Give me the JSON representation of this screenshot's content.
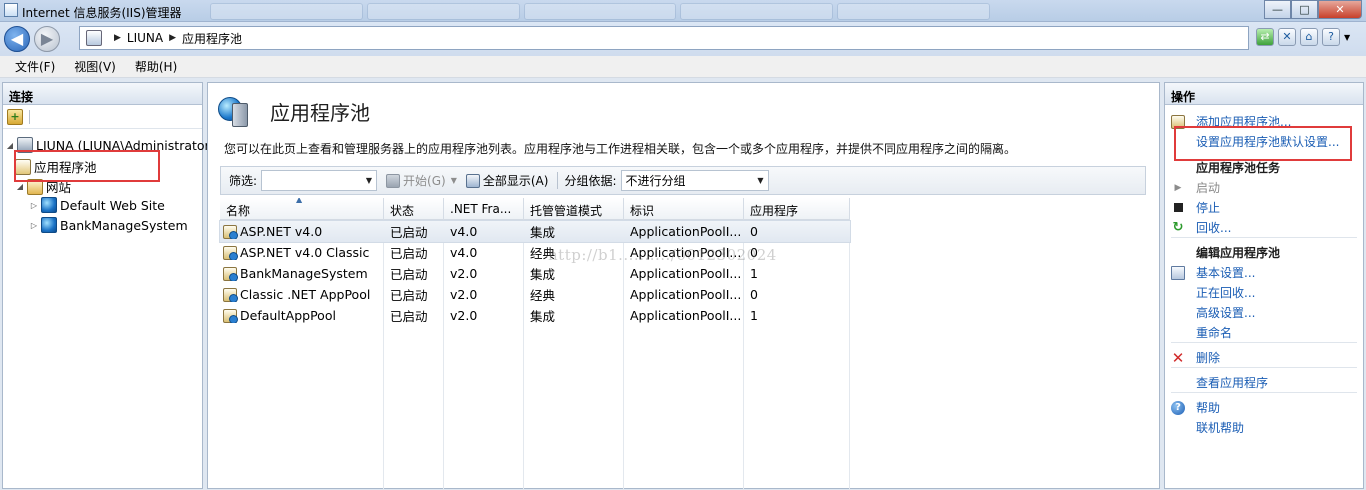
{
  "window": {
    "title": "Internet 信息服务(IIS)管理器",
    "buttons": {
      "minimize": "—",
      "maximize": "□",
      "close": "✕"
    }
  },
  "address": {
    "segments": [
      "LIUNA",
      "应用程序池"
    ]
  },
  "menu": [
    "文件(F)",
    "视图(V)",
    "帮助(H)"
  ],
  "connections": {
    "header": "连接",
    "tree": [
      {
        "label": "LIUNA (LIUNA\\Administrator)",
        "icon": "server-icon",
        "expander": "◢"
      },
      {
        "label": "应用程序池",
        "icon": "app-pool-icon",
        "expander": "",
        "selected": true
      },
      {
        "label": "网站",
        "icon": "sites-folder-icon",
        "expander": "◢"
      },
      {
        "label": "Default Web Site",
        "icon": "globe-icon",
        "expander": "▷"
      },
      {
        "label": "BankManageSystem",
        "icon": "globe-icon",
        "expander": "▷"
      }
    ]
  },
  "center": {
    "title": "应用程序池",
    "description": "您可以在此页上查看和管理服务器上的应用程序池列表。应用程序池与工作进程相关联，包含一个或多个应用程序，并提供不同应用程序之间的隔离。",
    "filter": {
      "label": "筛选:",
      "value": "",
      "go_label": "开始(G)",
      "show_all_label": "全部显示(A)",
      "group_label": "分组依据:",
      "group_value": "不进行分组"
    },
    "columns": [
      "名称",
      "状态",
      ".NET Fra...",
      "托管管道模式",
      "标识",
      "应用程序"
    ],
    "rows": [
      {
        "name": "ASP.NET v4.0",
        "status": "已启动",
        "net": "v4.0",
        "pipeline": "集成",
        "identity": "ApplicationPoolI...",
        "apps": "0"
      },
      {
        "name": "ASP.NET v4.0 Classic",
        "status": "已启动",
        "net": "v4.0",
        "pipeline": "经典",
        "identity": "ApplicationPoolI...",
        "apps": "0"
      },
      {
        "name": "BankManageSystem",
        "status": "已启动",
        "net": "v2.0",
        "pipeline": "集成",
        "identity": "ApplicationPoolI...",
        "apps": "1"
      },
      {
        "name": "Classic .NET AppPool",
        "status": "已启动",
        "net": "v2.0",
        "pipeline": "经典",
        "identity": "ApplicationPoolI...",
        "apps": "0"
      },
      {
        "name": "DefaultAppPool",
        "status": "已启动",
        "net": "v2.0",
        "pipeline": "集成",
        "identity": "ApplicationPoolI...",
        "apps": "1"
      }
    ],
    "watermark": "http://b1........../0012302024"
  },
  "actions": {
    "header": "操作",
    "add_pool": "添加应用程序池...",
    "set_defaults": "设置应用程序池默认设置...",
    "tasks_header": "应用程序池任务",
    "start": "启动",
    "stop": "停止",
    "recycle": "回收...",
    "edit_header": "编辑应用程序池",
    "basic_settings": "基本设置...",
    "recycling": "正在回收...",
    "advanced_settings": "高级设置...",
    "rename": "重命名",
    "delete": "删除",
    "view_apps": "查看应用程序",
    "help": "帮助",
    "online_help": "联机帮助"
  },
  "colors": {
    "link": "#1a5db4",
    "highlight_box": "#e03b3b"
  }
}
